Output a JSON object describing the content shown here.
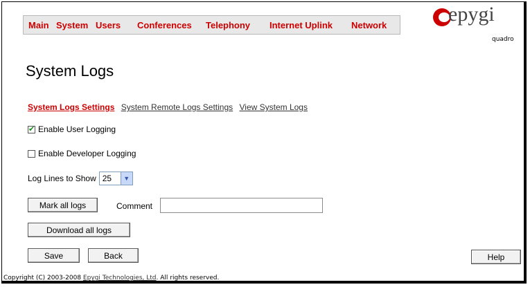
{
  "nav": {
    "items": [
      "Main",
      "System",
      "Users",
      "Conferences",
      "Telephony",
      "Internet Uplink",
      "Network"
    ]
  },
  "logo": {
    "text": "epygi",
    "subtext": "quadro"
  },
  "page": {
    "title": "System Logs"
  },
  "tabs": {
    "items": [
      "System Logs Settings",
      "System Remote Logs Settings",
      "View System Logs"
    ],
    "active": 0
  },
  "settings": {
    "enable_user_logging": {
      "label": "Enable User Logging",
      "checked": true
    },
    "enable_developer_logging": {
      "label": "Enable Developer Logging",
      "checked": false
    },
    "log_lines": {
      "label": "Log Lines to Show",
      "value": "25"
    }
  },
  "buttons": {
    "mark_all_logs": "Mark all logs",
    "download_all_logs": "Download all logs",
    "save": "Save",
    "back": "Back",
    "help": "Help"
  },
  "comment": {
    "label": "Comment",
    "value": ""
  },
  "footer": {
    "prefix": "Copyright (C) 2003-2008 ",
    "link": "Epygi Technologies, Ltd",
    "suffix": ". All rights reserved."
  },
  "colors": {
    "accent": "#cc0000"
  }
}
